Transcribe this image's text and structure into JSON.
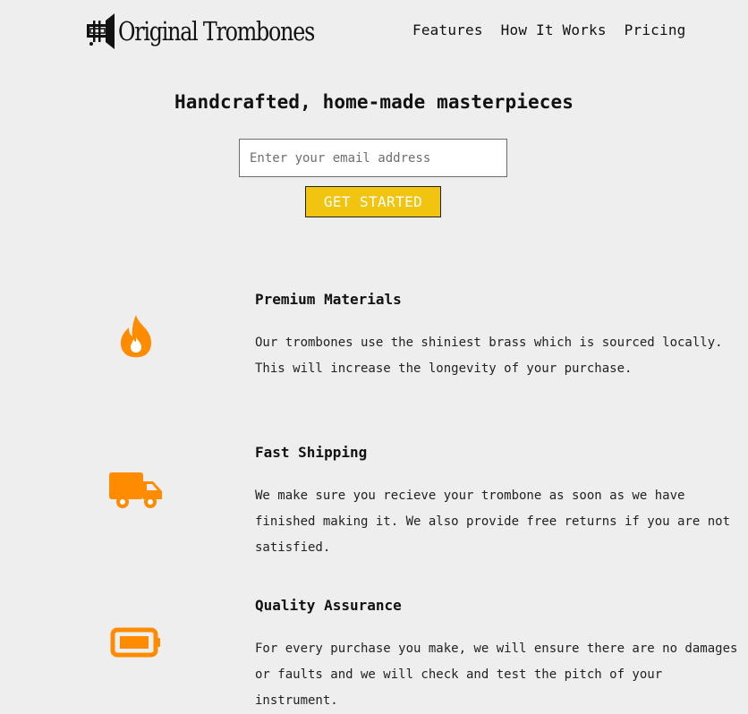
{
  "brand": {
    "name": "Original Trombones"
  },
  "nav": {
    "items": [
      "Features",
      "How It Works",
      "Pricing"
    ]
  },
  "hero": {
    "title": "Handcrafted, home-made masterpieces",
    "email_placeholder": "Enter your email address",
    "cta_label": "GET STARTED"
  },
  "colors": {
    "accent": "#f1c40f",
    "icon": "#ff8c00",
    "background": "#eeeeee"
  },
  "features": [
    {
      "icon": "fire-icon",
      "title": "Premium Materials",
      "description": "Our trombones use the shiniest brass which is sourced locally. This will increase the longevity of your purchase."
    },
    {
      "icon": "truck-icon",
      "title": "Fast Shipping",
      "description": "We make sure you recieve your trombone as soon as we have finished making it. We also provide free returns if you are not satisfied."
    },
    {
      "icon": "battery-icon",
      "title": "Quality Assurance",
      "description": "For every purchase you make, we will ensure there are no damages or faults and we will check and test the pitch of your instrument."
    }
  ]
}
